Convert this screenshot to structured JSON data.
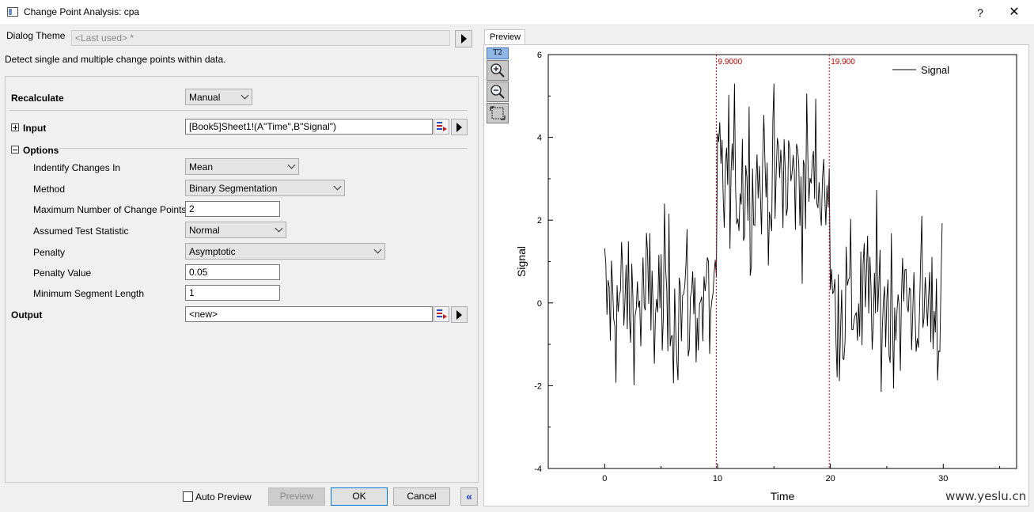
{
  "window": {
    "title": "Change Point Analysis: cpa",
    "help_label": "?",
    "close_label": "✕"
  },
  "dialog_theme": {
    "label": "Dialog Theme",
    "value": "<Last used> *"
  },
  "description": "Detect single and multiple change points within data.",
  "form": {
    "recalculate": {
      "label": "Recalculate",
      "value": "Manual"
    },
    "input": {
      "label": "Input",
      "value": "[Book5]Sheet1!(A\"Time\",B\"Signal\")"
    },
    "options": {
      "label": "Options",
      "identify": {
        "label": "Indentify Changes In",
        "value": "Mean"
      },
      "method": {
        "label": "Method",
        "value": "Binary Segmentation"
      },
      "max_points": {
        "label": "Maximum Number of Change Points",
        "value": "2"
      },
      "test_stat": {
        "label": "Assumed Test Statistic",
        "value": "Normal"
      },
      "penalty": {
        "label": "Penalty",
        "value": "Asymptotic"
      },
      "penalty_value": {
        "label": "Penalty Value",
        "value": "0.05"
      },
      "min_seg": {
        "label": "Minimum Segment Length",
        "value": "1"
      }
    },
    "output": {
      "label": "Output",
      "value": "<new>"
    }
  },
  "buttons": {
    "auto_preview": "Auto Preview",
    "preview": "Preview",
    "ok": "OK",
    "cancel": "Cancel",
    "collapse": "«"
  },
  "preview": {
    "tab_label": "Preview",
    "tool_label": "T2",
    "tools": [
      "zoom-in-icon",
      "zoom-out-icon",
      "rescale-icon"
    ]
  },
  "chart_data": {
    "type": "line",
    "xlabel": "Time",
    "ylabel": "Signal",
    "xlim": [
      -5,
      36.5
    ],
    "ylim": [
      -4,
      6
    ],
    "xticks": [
      0,
      10,
      20,
      30
    ],
    "yticks": [
      -4,
      -2,
      0,
      2,
      4,
      6
    ],
    "grid": false,
    "legend": {
      "position": "top-right",
      "entries": [
        "Signal"
      ]
    },
    "series": [
      {
        "name": "Signal",
        "color": "#000000",
        "segments": [
          {
            "x_start": 0.0,
            "x_end": 9.9,
            "mean": 0,
            "sd": 1
          },
          {
            "x_start": 10.0,
            "x_end": 19.9,
            "mean": 3,
            "sd": 1
          },
          {
            "x_start": 20.0,
            "x_end": 29.9,
            "mean": 0,
            "sd": 1
          }
        ],
        "x_step": 0.1
      }
    ],
    "change_points": [
      {
        "x": 9.9,
        "label": "9.9000",
        "color": "#cc0000"
      },
      {
        "x": 19.9,
        "label": "19.900",
        "color": "#cc0000"
      }
    ]
  },
  "watermark": "www.yeslu.cn"
}
